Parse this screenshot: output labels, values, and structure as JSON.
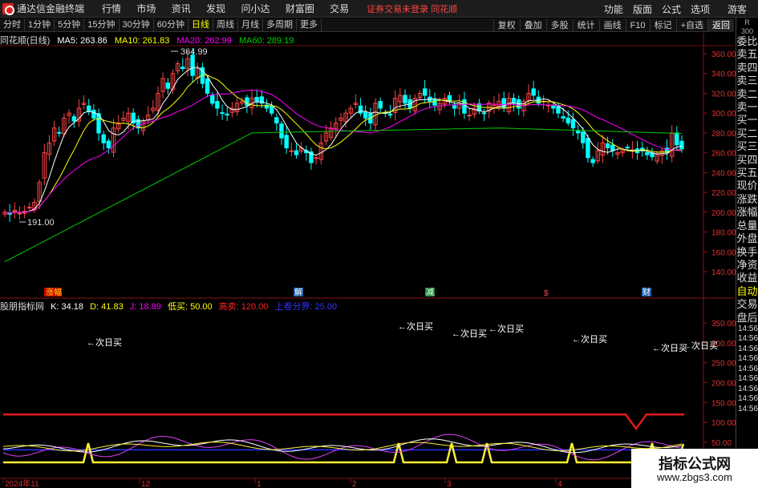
{
  "app": {
    "title": "通达信金融终端",
    "menus": [
      "行情",
      "市场",
      "资讯",
      "发现",
      "问小达",
      "财富圈",
      "交易"
    ],
    "login_warning": "证券交易未登录 同花顺",
    "right_menus": [
      "功能",
      "版面",
      "公式",
      "选项"
    ],
    "guest": "游客"
  },
  "toolbar": {
    "periods": [
      "分时",
      "1分钟",
      "5分钟",
      "15分钟",
      "30分钟",
      "60分钟",
      "日线",
      "周线",
      "月线",
      "多周期",
      "更多"
    ],
    "active": "日线",
    "right_items": [
      "复权",
      "叠加",
      "多股",
      "统计",
      "画线",
      "F10",
      "标记",
      "+自选",
      "返回"
    ]
  },
  "main": {
    "stock_label": "同花顺(日线)",
    "ma5": "MA5: 263.86",
    "ma10": "MA10: 261.83",
    "ma20": "MA20: 262.99",
    "ma60": "MA60: 289.19",
    "high_label": "364.99",
    "low_label": "191.00",
    "price_ticks": [
      "360.00",
      "340.00",
      "320.00",
      "300.00",
      "280.00",
      "260.00",
      "240.00",
      "220.00",
      "200.00",
      "180.00",
      "160.00",
      "140.00"
    ],
    "markers": [
      "涨幅",
      "解",
      "减",
      "$",
      "财"
    ]
  },
  "indicator": {
    "name": "股朋指标网",
    "k": "K: 34.18",
    "d": "D: 41.83",
    "j": "J: 18.89",
    "low_buy": "低买: 50.00",
    "high_sell": "高卖: 120.00",
    "up_break": "上卷分界: 25.00",
    "next_day_buy": "←次日买",
    "ticks": [
      "350.00",
      "300.00",
      "250.00",
      "200.00",
      "150.00",
      "100.00",
      "50.00"
    ]
  },
  "date_axis": [
    "2024年11",
    "12",
    "1",
    "2",
    "3",
    "4"
  ],
  "sidebar": {
    "header": [
      "R",
      "300"
    ],
    "items": [
      "委比",
      "卖五",
      "卖四",
      "卖三",
      "卖二",
      "卖一",
      "买一",
      "买二",
      "买三",
      "买四",
      "买五",
      "现价",
      "涨跌",
      "涨幅",
      "总量",
      "外盘",
      "换手",
      "净资",
      "收益"
    ],
    "mode": "自动",
    "trade": "交易",
    "after": "盘后",
    "times": [
      "14:56",
      "14:56",
      "14:56",
      "14:56",
      "14:56",
      "14:56",
      "14:56",
      "14:56",
      "14:56"
    ]
  },
  "watermark": {
    "line1": "指标公式网",
    "line2": "www.zbgs3.com"
  },
  "colors": {
    "ma5": "#ffffff",
    "ma10": "#ffff00",
    "ma20": "#ff00ff",
    "ma60": "#00cc00",
    "up": "#ff4444",
    "down": "#00ffff"
  }
}
